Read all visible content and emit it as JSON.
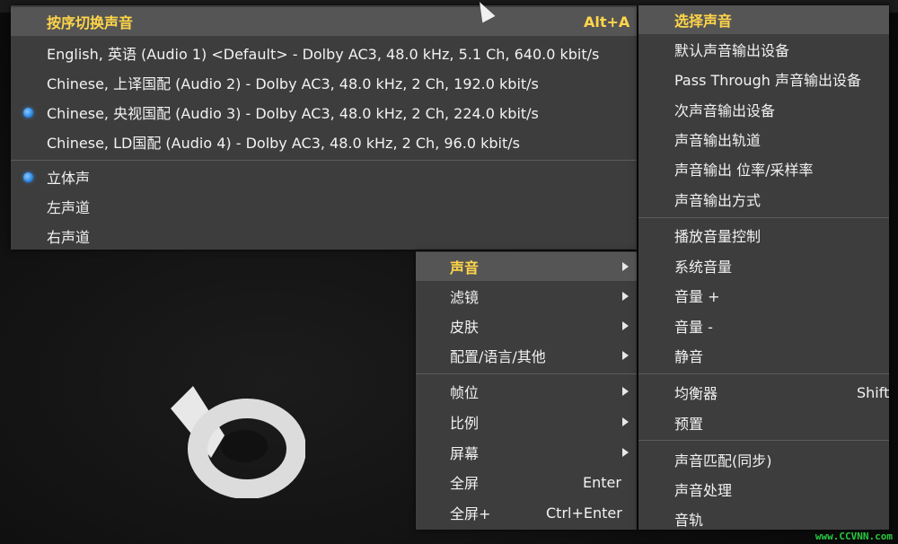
{
  "audio_menu": {
    "header": "按序切换声音",
    "header_shortcut": "Alt+A",
    "tracks": [
      {
        "label": "English, 英语 (Audio 1) <Default> - Dolby AC3, 48.0 kHz, 5.1 Ch, 640.0 kbit/s",
        "selected": false
      },
      {
        "label": "Chinese, 上译国配 (Audio 2) - Dolby AC3, 48.0 kHz, 2 Ch, 192.0 kbit/s",
        "selected": false
      },
      {
        "label": "Chinese, 央视国配 (Audio 3) - Dolby AC3, 48.0 kHz, 2 Ch, 224.0 kbit/s",
        "selected": true
      },
      {
        "label": "Chinese, LD国配 (Audio 4) - Dolby AC3, 48.0 kHz, 2 Ch, 96.0 kbit/s",
        "selected": false
      }
    ],
    "channels": [
      {
        "label": "立体声",
        "selected": true
      },
      {
        "label": "左声道",
        "selected": false
      },
      {
        "label": "右声道",
        "selected": false
      }
    ]
  },
  "context_menu": {
    "items": [
      {
        "label": "声音",
        "submenu": true,
        "shortcut": "",
        "active": true
      },
      {
        "label": "滤镜",
        "submenu": true,
        "shortcut": ""
      },
      {
        "label": "皮肤",
        "submenu": true,
        "shortcut": ""
      },
      {
        "label": "配置/语言/其他",
        "submenu": true,
        "shortcut": ""
      },
      {
        "label": "帧位",
        "submenu": true,
        "shortcut": ""
      },
      {
        "label": "比例",
        "submenu": true,
        "shortcut": ""
      },
      {
        "label": "屏幕",
        "submenu": true,
        "shortcut": ""
      },
      {
        "label": "全屏",
        "submenu": false,
        "shortcut": "Enter"
      },
      {
        "label": "全屏+",
        "submenu": false,
        "shortcut": "Ctrl+Enter"
      }
    ]
  },
  "sound_menu": {
    "items": [
      {
        "label": "选择声音",
        "shortcut": "",
        "highlight": true
      },
      {
        "label": "默认声音输出设备",
        "shortcut": ""
      },
      {
        "label": "Pass Through 声音输出设备",
        "shortcut": ""
      },
      {
        "label": "次声音输出设备",
        "shortcut": ""
      },
      {
        "label": "声音输出轨道",
        "shortcut": ""
      },
      {
        "label": "声音输出 位率/采样率",
        "shortcut": ""
      },
      {
        "label": "声音输出方式",
        "shortcut": ""
      },
      {
        "label": "播放音量控制",
        "shortcut": ""
      },
      {
        "label": "系统音量",
        "shortcut": ""
      },
      {
        "label": "音量 +",
        "shortcut": ""
      },
      {
        "label": "音量 -",
        "shortcut": ""
      },
      {
        "label": "静音",
        "shortcut": ""
      },
      {
        "label": "均衡器",
        "shortcut": "Shift"
      },
      {
        "label": "预置",
        "shortcut": ""
      },
      {
        "label": "声音匹配(同步)",
        "shortcut": ""
      },
      {
        "label": "声音处理",
        "shortcut": ""
      },
      {
        "label": "音轨",
        "shortcut": ""
      }
    ]
  },
  "watermark": "www.CCVNN.com",
  "colors": {
    "menu_bg": "#3d3d3d",
    "highlight": "#555555",
    "accent_yellow": "#ffd54a",
    "radio_blue": "#1e7fe0"
  }
}
